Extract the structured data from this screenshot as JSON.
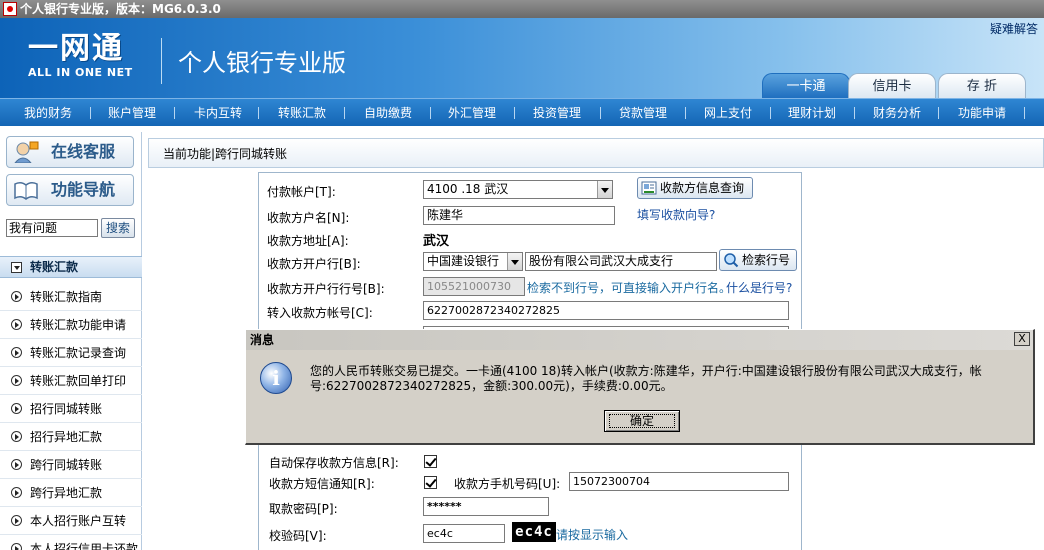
{
  "window": {
    "title": "个人银行专业版，版本：MG6.0.3.0"
  },
  "header": {
    "logo_cn": "一网通",
    "logo_en": "ALL IN ONE NET",
    "app_title": "个人银行专业版",
    "help": "疑难解答",
    "tabs": [
      {
        "label": "一卡通",
        "active": true
      },
      {
        "label": "信用卡",
        "active": false
      },
      {
        "label": "存 折",
        "active": false
      }
    ]
  },
  "nav": {
    "items": [
      "我的财务",
      "账户管理",
      "卡内互转",
      "转账汇款",
      "自助缴费",
      "外汇管理",
      "投资管理",
      "贷款管理",
      "网上支付",
      "理财计划",
      "财务分析",
      "功能申请"
    ]
  },
  "sidebar": {
    "online_service": "在线客服",
    "function_nav": "功能导航",
    "search_value": "我有问题",
    "search_button": "搜索",
    "section_title": "转账汇款",
    "items": [
      "转账汇款指南",
      "转账汇款功能申请",
      "转账汇款记录查询",
      "转账汇款回单打印",
      "招行同城转账",
      "招行异地汇款",
      "跨行同城转账",
      "跨行异地汇款",
      "本人招行账户互转",
      "本人招行信用卡还款"
    ]
  },
  "main": {
    "breadcrumb": "当前功能|跨行同城转账",
    "form": {
      "payer_account_label": "付款帐户[T]:",
      "payer_account_value": "4100              .18     武汉",
      "payee_query_button": "收款方信息查询",
      "payee_name_label": "收款方户名[N]:",
      "payee_name_value": "陈建华",
      "fill_guide_link": "填写收款向导?",
      "payee_address_label": "收款方地址[A]:",
      "payee_address_value": "武汉",
      "payee_bank_label": "收款方开户行[B]:",
      "payee_bank_select": "中国建设银行",
      "payee_bank_branch": "股份有限公司武汉大成支行",
      "search_bank_code_button": "检索行号",
      "bank_code_label": "收款方开户行行号[B]:",
      "bank_code_value": "105521000730",
      "bank_code_hint": "检索不到行号，可直接输入开户行名。",
      "bank_code_help_link": "什么是行号?",
      "payee_account_label": "转入收款方帐号[C]:",
      "payee_account_value": "6227002872340272825",
      "auto_save_label": "自动保存收款方信息[R]:",
      "sms_notify_label": "收款方短信通知[R]:",
      "payee_mobile_label": "收款方手机号码[U]:",
      "payee_mobile_value": "15072300704",
      "password_label": "取款密码[P]:",
      "password_value": "******",
      "captcha_label": "校验码[V]:",
      "captcha_input_value": "ec4c",
      "captcha_image_text": "ec4c",
      "captcha_hint": "请按显示输入"
    }
  },
  "dialog": {
    "title": "消息",
    "close": "X",
    "message": "您的人民币转账交易已提交。一卡通(4100              18)转入帐户(收款方:陈建华，开户行:中国建设银行股份有限公司武汉大成支行，帐号:6227002872340272825，金额:300.00元)，手续费:0.00元。",
    "ok_button": "确定"
  }
}
